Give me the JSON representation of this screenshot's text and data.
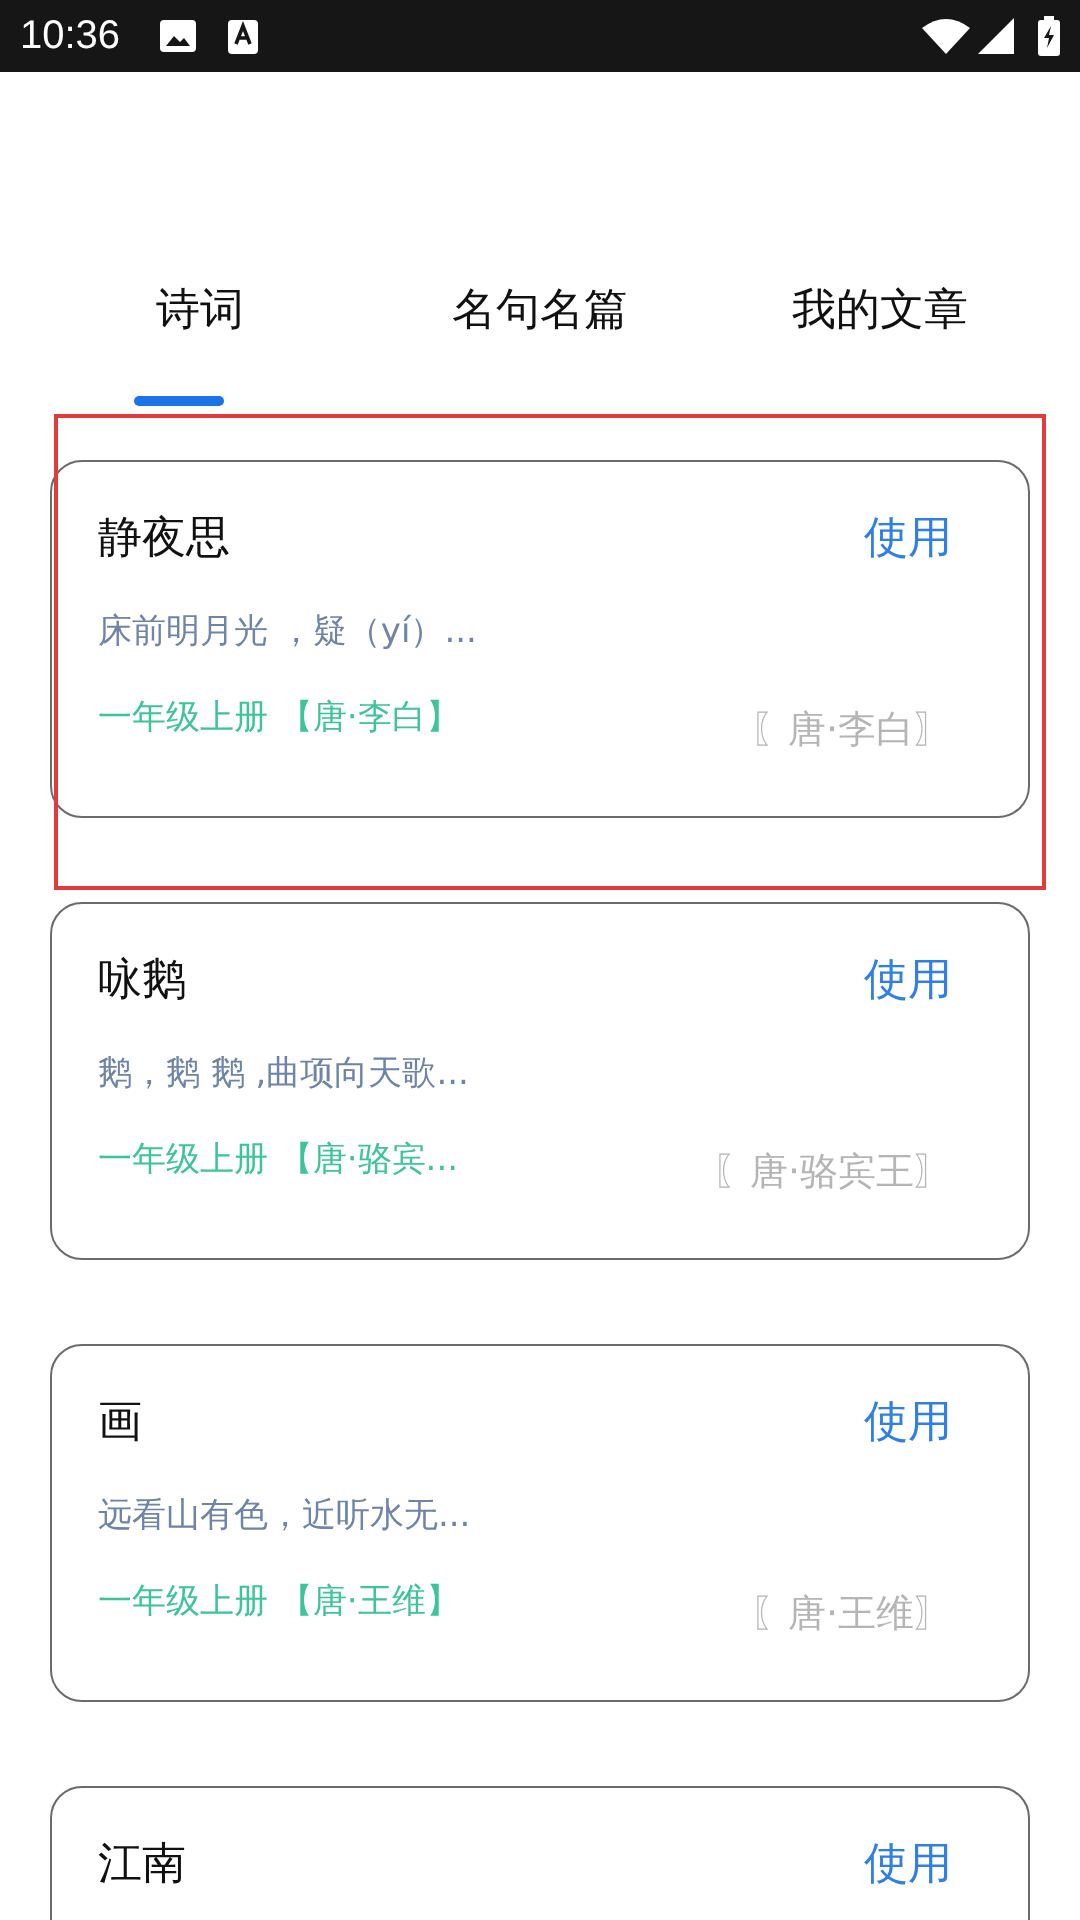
{
  "status_bar": {
    "time": "10:36"
  },
  "tabs": [
    {
      "label": "诗词",
      "selected": true
    },
    {
      "label": "名句名篇",
      "selected": false
    },
    {
      "label": "我的文章",
      "selected": false
    }
  ],
  "poems": [
    {
      "title": "静夜思",
      "action": "使用",
      "excerpt": "床前明月光 ，疑（yí）...",
      "grade": "一年级上册 【唐·李白】",
      "author": "〖唐·李白〗",
      "highlighted": true
    },
    {
      "title": "咏鹅",
      "action": "使用",
      "excerpt": "鹅，鹅 鹅 ,曲项向天歌...",
      "grade": "一年级上册 【唐·骆宾...",
      "author": "〖唐·骆宾王〗",
      "highlighted": false
    },
    {
      "title": "画",
      "action": "使用",
      "excerpt": "远看山有色，近听水无...",
      "grade": "一年级上册 【唐·王维】",
      "author": "〖唐·王维〗",
      "highlighted": false
    },
    {
      "title": "江南",
      "action": "使用",
      "highlighted": false
    }
  ]
}
